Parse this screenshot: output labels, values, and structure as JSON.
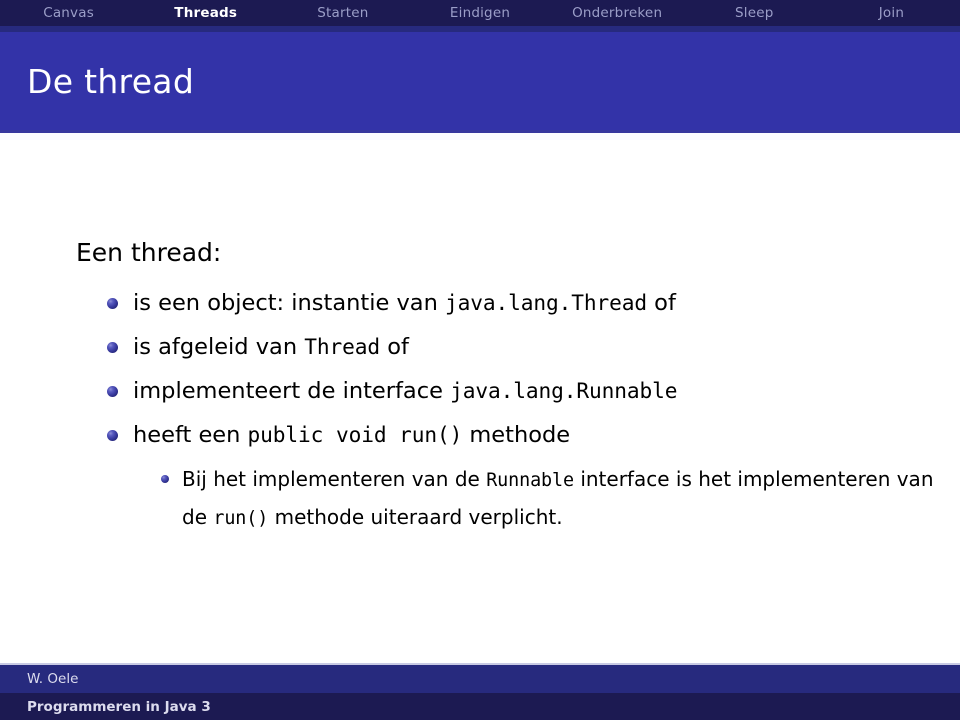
{
  "navbar": {
    "items": [
      {
        "label": "Canvas",
        "active": false
      },
      {
        "label": "Threads",
        "active": true
      },
      {
        "label": "Starten",
        "active": false
      },
      {
        "label": "Eindigen",
        "active": false
      },
      {
        "label": "Onderbreken",
        "active": false
      },
      {
        "label": "Sleep",
        "active": false
      },
      {
        "label": "Join",
        "active": false
      }
    ]
  },
  "header": {
    "title": "De thread"
  },
  "main": {
    "block_heading": "Een thread:",
    "bullets": [
      {
        "parts": [
          {
            "text": "is een object: instantie van ",
            "mono": false
          },
          {
            "text": "java.lang.Thread",
            "mono": true
          },
          {
            "text": " of",
            "mono": false
          }
        ]
      },
      {
        "parts": [
          {
            "text": "is afgeleid van ",
            "mono": false
          },
          {
            "text": "Thread",
            "mono": true
          },
          {
            "text": " of",
            "mono": false
          }
        ]
      },
      {
        "parts": [
          {
            "text": "implementeert de interface ",
            "mono": false
          },
          {
            "text": "java.lang.Runnable",
            "mono": true
          }
        ]
      },
      {
        "parts": [
          {
            "text": "heeft een ",
            "mono": false
          },
          {
            "text": "public void run()",
            "mono": true
          },
          {
            "text": " methode",
            "mono": false
          }
        ],
        "sub": [
          {
            "parts": [
              {
                "text": "Bij het implementeren van de ",
                "mono": false
              },
              {
                "text": "Runnable",
                "mono": true
              },
              {
                "text": " interface is het implementeren van de ",
                "mono": false
              },
              {
                "text": "run()",
                "mono": true
              },
              {
                "text": " methode uiteraard verplicht.",
                "mono": false
              }
            ]
          }
        ]
      }
    ]
  },
  "footer": {
    "author": "W. Oele",
    "course": "Programmeren in Java 3"
  },
  "colors": {
    "nav_bg": "#1c1a52",
    "nav_stripe": "#272a7e",
    "title_bg": "#3333a8",
    "nav_inactive_text": "#9b9ec8",
    "nav_active_text": "#ffffff",
    "bullet": "#3d3fa5",
    "body_text": "#000000",
    "footer_author_bg": "#272a7e",
    "footer_course_bg": "#1c1a52"
  }
}
